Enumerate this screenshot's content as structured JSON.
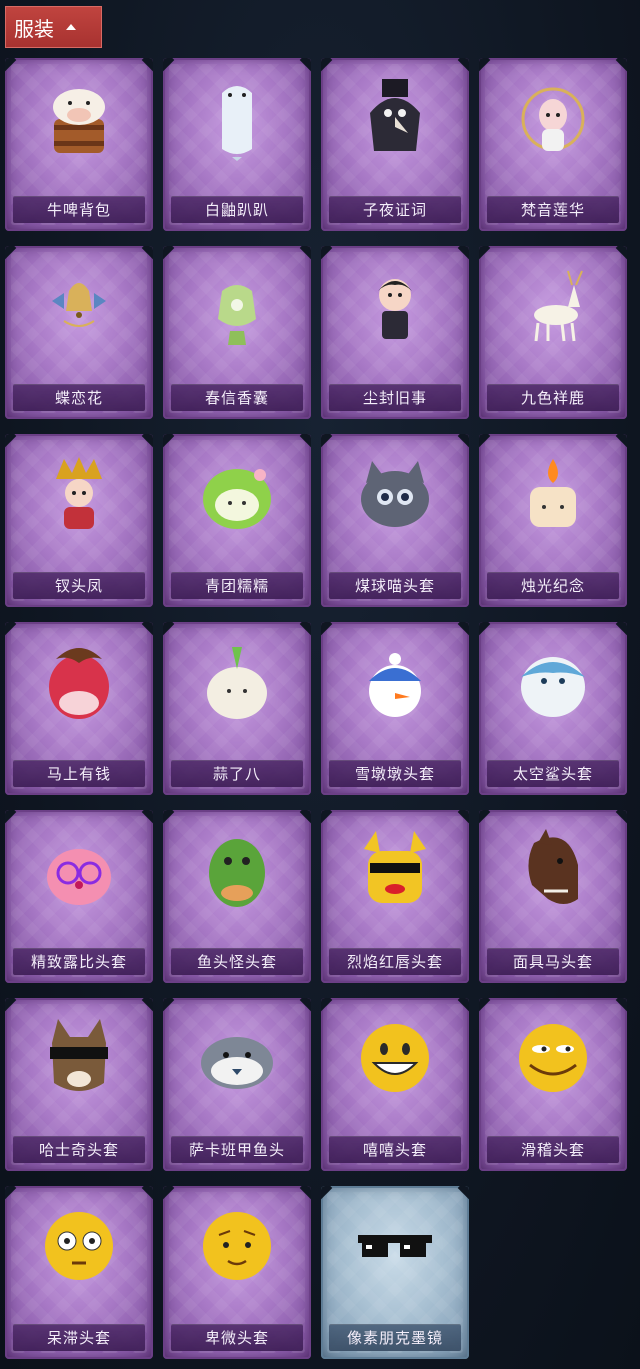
{
  "header": {
    "title": "服装"
  },
  "items": [
    {
      "label": "牛啤背包",
      "icon": "cow-beer-backpack-icon",
      "theme": "purple"
    },
    {
      "label": "白鼬趴趴",
      "icon": "white-ferret-icon",
      "theme": "purple"
    },
    {
      "label": "子夜证词",
      "icon": "plague-doctor-icon",
      "theme": "purple"
    },
    {
      "label": "梵音莲华",
      "icon": "lotus-doll-icon",
      "theme": "purple"
    },
    {
      "label": "蝶恋花",
      "icon": "butterfly-bell-icon",
      "theme": "purple"
    },
    {
      "label": "春信香囊",
      "icon": "sachet-icon",
      "theme": "purple"
    },
    {
      "label": "尘封旧事",
      "icon": "vampire-doll-icon",
      "theme": "purple"
    },
    {
      "label": "九色祥鹿",
      "icon": "deer-icon",
      "theme": "purple"
    },
    {
      "label": "钗头凤",
      "icon": "phoenix-crown-doll-icon",
      "theme": "purple"
    },
    {
      "label": "青团糯糯",
      "icon": "green-dumpling-icon",
      "theme": "purple"
    },
    {
      "label": "煤球喵头套",
      "icon": "gray-cat-head-icon",
      "theme": "purple"
    },
    {
      "label": "烛光纪念",
      "icon": "candle-icon",
      "theme": "purple"
    },
    {
      "label": "马上有钱",
      "icon": "red-horse-head-icon",
      "theme": "purple"
    },
    {
      "label": "蒜了八",
      "icon": "garlic-head-icon",
      "theme": "purple"
    },
    {
      "label": "雪墩墩头套",
      "icon": "snowman-head-icon",
      "theme": "purple"
    },
    {
      "label": "太空鲨头套",
      "icon": "shark-head-icon",
      "theme": "purple"
    },
    {
      "label": "精致露比头套",
      "icon": "pink-beaver-head-icon",
      "theme": "purple"
    },
    {
      "label": "鱼头怪头套",
      "icon": "fish-monster-head-icon",
      "theme": "purple"
    },
    {
      "label": "烈焰红唇头套",
      "icon": "yellow-mouse-head-icon",
      "theme": "purple"
    },
    {
      "label": "面具马头套",
      "icon": "horse-mask-icon",
      "theme": "purple"
    },
    {
      "label": "哈士奇头套",
      "icon": "husky-head-icon",
      "theme": "purple"
    },
    {
      "label": "萨卡班甲鱼头",
      "icon": "sacabambaspis-head-icon",
      "theme": "purple"
    },
    {
      "label": "嘻嘻头套",
      "icon": "grin-emoji-head-icon",
      "theme": "purple"
    },
    {
      "label": "滑稽头套",
      "icon": "funny-emoji-head-icon",
      "theme": "purple"
    },
    {
      "label": "呆滞头套",
      "icon": "dazed-emoji-head-icon",
      "theme": "purple"
    },
    {
      "label": "卑微头套",
      "icon": "humble-emoji-head-icon",
      "theme": "purple"
    },
    {
      "label": "像素朋克墨镜",
      "icon": "pixel-sunglasses-icon",
      "theme": "blue"
    }
  ]
}
